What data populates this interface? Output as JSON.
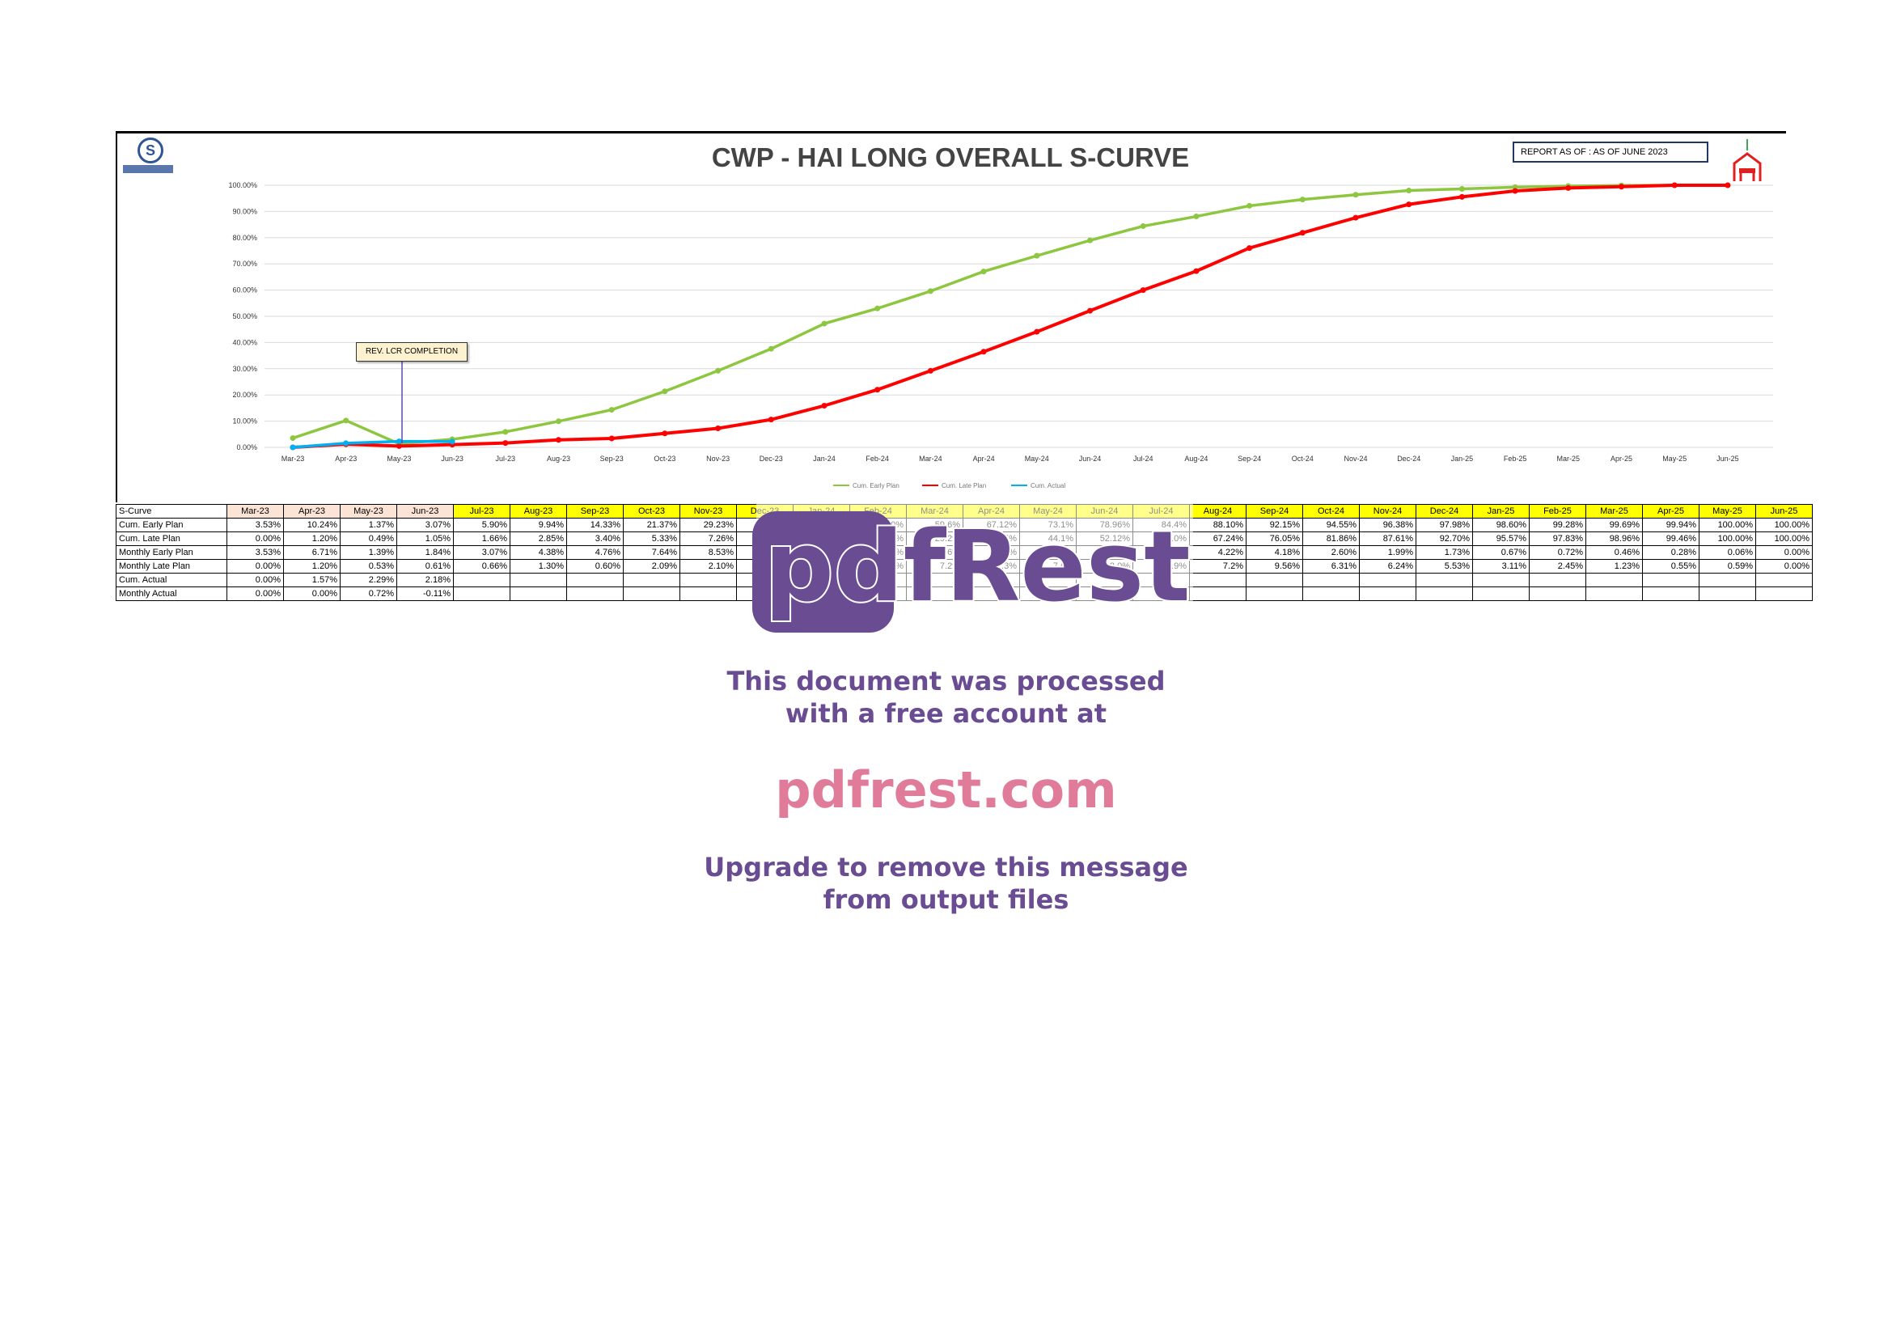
{
  "chart_data": {
    "type": "line",
    "title": "CWP - HAI LONG OVERALL S-CURVE",
    "report_label": "REPORT AS OF : AS OF JUNE 2023",
    "annotation": "REV. LCR COMPLETION",
    "x": [
      "Mar-23",
      "Apr-23",
      "May-23",
      "Jun-23",
      "Jul-23",
      "Aug-23",
      "Sep-23",
      "Oct-23",
      "Nov-23",
      "Dec-23",
      "Jan-24",
      "Feb-24",
      "Mar-24",
      "Apr-24",
      "May-24",
      "Jun-24",
      "Jul-24",
      "Aug-24",
      "Sep-24",
      "Oct-24",
      "Nov-24",
      "Dec-24",
      "Jan-25",
      "Feb-25",
      "Mar-25",
      "Apr-25",
      "May-25",
      "Jun-25"
    ],
    "yticks": [
      "0.00%",
      "10.00%",
      "20.00%",
      "30.00%",
      "40.00%",
      "50.00%",
      "60.00%",
      "70.00%",
      "80.00%",
      "90.00%",
      "100.00%"
    ],
    "ylim": [
      0,
      100
    ],
    "grid": true,
    "legend_position": "bottom",
    "series": [
      {
        "name": "Cum. Early Plan",
        "color": "#8dc63f",
        "values": [
          3.53,
          10.24,
          1.37,
          3.07,
          5.9,
          9.94,
          14.33,
          21.37,
          29.23,
          37.6,
          47.2,
          53.0,
          59.6,
          67.1,
          73.1,
          78.96,
          84.4,
          88.1,
          92.15,
          94.55,
          96.38,
          97.98,
          98.6,
          99.28,
          99.69,
          99.94,
          100.0,
          100.0
        ]
      },
      {
        "name": "Cum. Late Plan",
        "color": "#ff0000",
        "values": [
          0.0,
          1.2,
          0.49,
          1.05,
          1.66,
          2.85,
          3.4,
          5.33,
          7.26,
          10.6,
          15.9,
          22.0,
          29.2,
          36.5,
          44.1,
          52.12,
          60.0,
          67.24,
          76.05,
          81.86,
          87.61,
          92.7,
          95.57,
          97.83,
          98.96,
          99.46,
          100.0,
          100.0
        ]
      },
      {
        "name": "Cum. Actual",
        "color": "#00b0f0",
        "values": [
          0.0,
          1.57,
          2.29,
          2.18
        ]
      }
    ],
    "table": {
      "header_label": "S-Curve",
      "rows": [
        {
          "label": "Cum. Early Plan",
          "values": [
            "3.53%",
            "10.24%",
            "1.37%",
            "3.07%",
            "5.90%",
            "9.94%",
            "14.33%",
            "21.37%",
            "29.23%",
            "37.6%",
            "47.22%",
            "53.0%",
            "59.6%",
            "67.12%",
            "73.1%",
            "78.96%",
            "84.4%",
            "88.10%",
            "92.15%",
            "94.55%",
            "96.38%",
            "97.98%",
            "98.60%",
            "99.28%",
            "99.69%",
            "99.94%",
            "100.00%",
            "100.00%"
          ]
        },
        {
          "label": "Cum. Late Plan",
          "values": [
            "0.00%",
            "1.20%",
            "0.49%",
            "1.05%",
            "1.66%",
            "2.85%",
            "3.40%",
            "5.33%",
            "7.26%",
            "10.6%",
            "15.9%",
            "22.0%",
            "29.2%",
            "36.5%",
            "44.1%",
            "52.12%",
            "60.0%",
            "67.24%",
            "76.05%",
            "81.86%",
            "87.61%",
            "92.70%",
            "95.57%",
            "97.83%",
            "98.96%",
            "99.46%",
            "100.00%",
            "100.00%"
          ]
        },
        {
          "label": "Monthly Early Plan",
          "values": [
            "3.53%",
            "6.71%",
            "1.39%",
            "1.84%",
            "3.07%",
            "4.38%",
            "4.76%",
            "7.64%",
            "8.53%",
            "9.12%",
            "9.6%",
            "5.8%",
            "6.6%",
            "7.5%",
            "6.0%",
            "5.9%",
            "5.4%",
            "4.22%",
            "4.18%",
            "2.60%",
            "1.99%",
            "1.73%",
            "0.67%",
            "0.72%",
            "0.46%",
            "0.28%",
            "0.06%",
            "0.00%"
          ]
        },
        {
          "label": "Monthly Late Plan",
          "values": [
            "0.00%",
            "1.20%",
            "0.53%",
            "0.61%",
            "0.66%",
            "1.30%",
            "0.60%",
            "2.09%",
            "2.10%",
            "3.3%",
            "5.3%",
            "6.1%",
            "7.2%",
            "7.3%",
            "7.6%",
            "8.0%",
            "7.9%",
            "7.2%",
            "9.56%",
            "6.31%",
            "6.24%",
            "5.53%",
            "3.11%",
            "2.45%",
            "1.23%",
            "0.55%",
            "0.59%",
            "0.00%"
          ]
        },
        {
          "label": "Cum. Actual",
          "values": [
            "0.00%",
            "1.57%",
            "2.29%",
            "2.18%",
            "",
            "",
            "",
            "",
            "",
            "",
            "",
            "",
            "",
            "",
            "",
            "",
            "",
            "",
            "",
            "",
            "",
            "",
            "",
            "",
            "",
            "",
            "",
            ""
          ]
        },
        {
          "label": "Monthly Actual",
          "values": [
            "0.00%",
            "0.00%",
            "0.72%",
            "-0.11%",
            "",
            "",
            "",
            "",
            "",
            "",
            "",
            "",
            "",
            "",
            "",
            "",
            "",
            "",
            "",
            "",
            "",
            "",
            "",
            "",
            "",
            "",
            "",
            ""
          ]
        }
      ]
    }
  },
  "watermark": {
    "logo_text": "pdfRest",
    "line1": "This document was processed",
    "line2": "with a free account at",
    "url": "pdfrest.com",
    "upgrade1": "Upgrade to remove this message",
    "upgrade2": "from output files",
    "colors": {
      "purple": "#6a4c93",
      "pink": "#e07b9a"
    }
  }
}
